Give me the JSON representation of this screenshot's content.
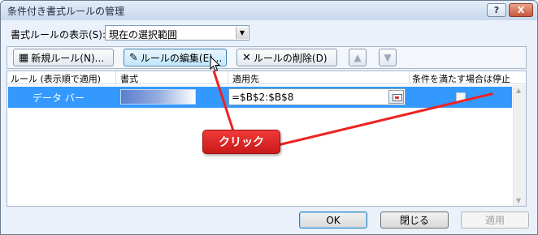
{
  "window": {
    "title": "条件付き書式ルールの管理",
    "help_label": "?",
    "close_label": "X"
  },
  "show_rules": {
    "label": "書式ルールの表示(S):",
    "selected": "現在の選択範囲"
  },
  "toolbar": {
    "new_rule": "新規ルール(N)...",
    "edit_rule": "ルールの編集(E)...",
    "delete_rule": "ルールの削除(D)"
  },
  "grid": {
    "columns": [
      "ルール (表示順で適用)",
      "書式",
      "適用先",
      "条件を満たす場合は停止"
    ],
    "rows": [
      {
        "rule": "データ バー",
        "applies_to": "=$B$2:$B$8",
        "stop_if_true": false
      }
    ]
  },
  "footer": {
    "ok": "OK",
    "close": "閉じる",
    "apply": "適用"
  },
  "callout": {
    "text": "クリック"
  },
  "colors": {
    "selected_row": "#3399ff",
    "callout": "#e02020"
  }
}
